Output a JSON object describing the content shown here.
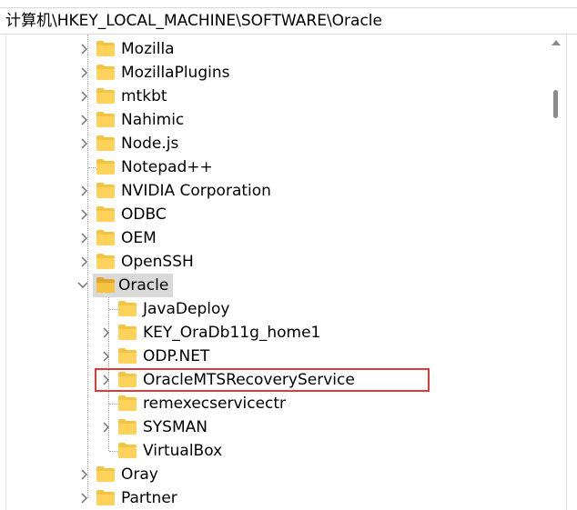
{
  "address_bar": {
    "path": "计算机\\HKEY_LOCAL_MACHINE\\SOFTWARE\\Oracle"
  },
  "tree": {
    "items": [
      {
        "label": "Mozilla",
        "expander": "collapsed"
      },
      {
        "label": "MozillaPlugins",
        "expander": "collapsed"
      },
      {
        "label": "mtkbt",
        "expander": "collapsed"
      },
      {
        "label": "Nahimic",
        "expander": "collapsed"
      },
      {
        "label": "Node.js",
        "expander": "collapsed"
      },
      {
        "label": "Notepad++",
        "expander": "none"
      },
      {
        "label": "NVIDIA Corporation",
        "expander": "collapsed"
      },
      {
        "label": "ODBC",
        "expander": "collapsed"
      },
      {
        "label": "OEM",
        "expander": "collapsed"
      },
      {
        "label": "OpenSSH",
        "expander": "collapsed"
      },
      {
        "label": "Oracle",
        "expander": "expanded",
        "selected": true
      },
      {
        "label": "Oray",
        "expander": "collapsed"
      },
      {
        "label": "Partner",
        "expander": "collapsed"
      }
    ],
    "oracle_children": [
      {
        "label": "JavaDeploy",
        "expander": "none"
      },
      {
        "label": "KEY_OraDb11g_home1",
        "expander": "collapsed"
      },
      {
        "label": "ODP.NET",
        "expander": "collapsed"
      },
      {
        "label": "OracleMTSRecoveryService",
        "expander": "collapsed",
        "highlighted": true
      },
      {
        "label": "remexecservicectr",
        "expander": "none"
      },
      {
        "label": "SYSMAN",
        "expander": "collapsed"
      },
      {
        "label": "VirtualBox",
        "expander": "none"
      }
    ]
  },
  "colors": {
    "folder": "#f5c342",
    "folder_dark": "#e2a72a",
    "selection": "#d9d9d9",
    "highlight_border": "#e0393b"
  }
}
